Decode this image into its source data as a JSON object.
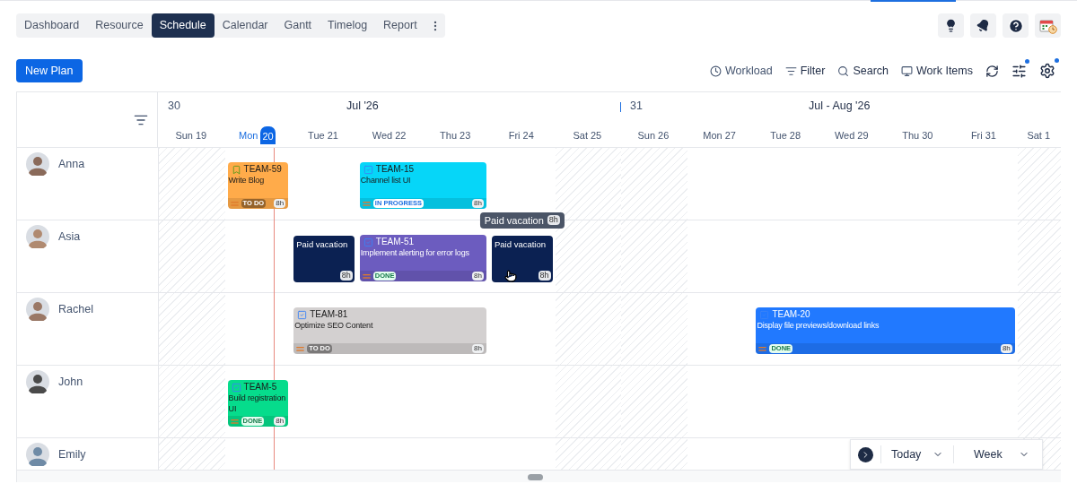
{
  "tabs": [
    {
      "label": "Dashboard",
      "selected": false
    },
    {
      "label": "Resource",
      "selected": false
    },
    {
      "label": "Schedule",
      "selected": true
    },
    {
      "label": "Calendar",
      "selected": false
    },
    {
      "label": "Gantt",
      "selected": false
    },
    {
      "label": "Timelog",
      "selected": false
    },
    {
      "label": "Report",
      "selected": false
    }
  ],
  "new_plan_button": "New Plan",
  "toolbar": [
    {
      "kind": "workload",
      "label": "Workload"
    },
    {
      "kind": "filter",
      "label": "Filter"
    },
    {
      "kind": "search",
      "label": "Search"
    },
    {
      "kind": "work_items",
      "label": "Work Items"
    }
  ],
  "weeks": [
    {
      "number": "30",
      "label": "Jul '26"
    },
    {
      "number": "31",
      "label": "Jul - Aug '26"
    }
  ],
  "days": [
    {
      "weekday": "Sun",
      "date": "19",
      "weekend": true,
      "today": false
    },
    {
      "weekday": "Mon",
      "date": "20",
      "weekend": false,
      "today": true
    },
    {
      "weekday": "Tue",
      "date": "21",
      "weekend": false,
      "today": false
    },
    {
      "weekday": "Wed",
      "date": "22",
      "weekend": false,
      "today": false
    },
    {
      "weekday": "Thu",
      "date": "23",
      "weekend": false,
      "today": false
    },
    {
      "weekday": "Fri",
      "date": "24",
      "weekend": false,
      "today": false
    },
    {
      "weekday": "Sat",
      "date": "25",
      "weekend": true,
      "today": false
    },
    {
      "weekday": "Sun",
      "date": "26",
      "weekend": true,
      "today": false
    },
    {
      "weekday": "Mon",
      "date": "27",
      "weekend": false,
      "today": false
    },
    {
      "weekday": "Tue",
      "date": "28",
      "weekend": false,
      "today": false
    },
    {
      "weekday": "Wed",
      "date": "29",
      "weekend": false,
      "today": false
    },
    {
      "weekday": "Thu",
      "date": "30",
      "weekend": false,
      "today": false
    },
    {
      "weekday": "Fri",
      "date": "31",
      "weekend": false,
      "today": false
    },
    {
      "weekday": "Sat",
      "date": "1",
      "weekend": true,
      "today": false
    }
  ],
  "people": [
    {
      "name": "Anna",
      "events": [
        {
          "kind": "story",
          "key": "TEAM-59",
          "title": "Write Blog",
          "status": "TO DO",
          "hours": "8h",
          "color": "#ffab4a"
        },
        {
          "kind": "task",
          "key": "TEAM-15",
          "title": "Channel list UI",
          "status": "IN PROGRESS",
          "hours": "8h",
          "color": "#06d6f8"
        }
      ]
    },
    {
      "name": "Asia",
      "events": [
        {
          "kind": "vacation",
          "title": "Paid vacation",
          "hours": "8h",
          "color": "#0b2152"
        },
        {
          "kind": "task",
          "key": "TEAM-51",
          "title": "Implement alerting for error logs",
          "status": "DONE",
          "hours": "8h",
          "color": "#6c5cbf"
        },
        {
          "kind": "vacation",
          "title": "Paid vacation",
          "hours": "8h",
          "color": "#0b2152",
          "tooltip": {
            "title": "Paid vacation",
            "hours": "8h"
          }
        }
      ]
    },
    {
      "name": "Rachel",
      "events": [
        {
          "kind": "task",
          "key": "TEAM-81",
          "title": "Optimize SEO Content",
          "status": "TO DO",
          "hours": "8h",
          "color": "#d3d0d0"
        },
        {
          "kind": "task",
          "key": "TEAM-20",
          "title": "Display file previews/download links",
          "status": "DONE",
          "hours": "8h",
          "color": "#2179ff"
        }
      ]
    },
    {
      "name": "John",
      "events": [
        {
          "kind": "task",
          "key": "TEAM-5",
          "title": "Build registration UI",
          "status": "DONE",
          "hours": "8h",
          "color": "#06dc8c"
        }
      ]
    },
    {
      "name": "Emily"
    }
  ],
  "navigator": {
    "today": "Today",
    "view": "Week"
  }
}
